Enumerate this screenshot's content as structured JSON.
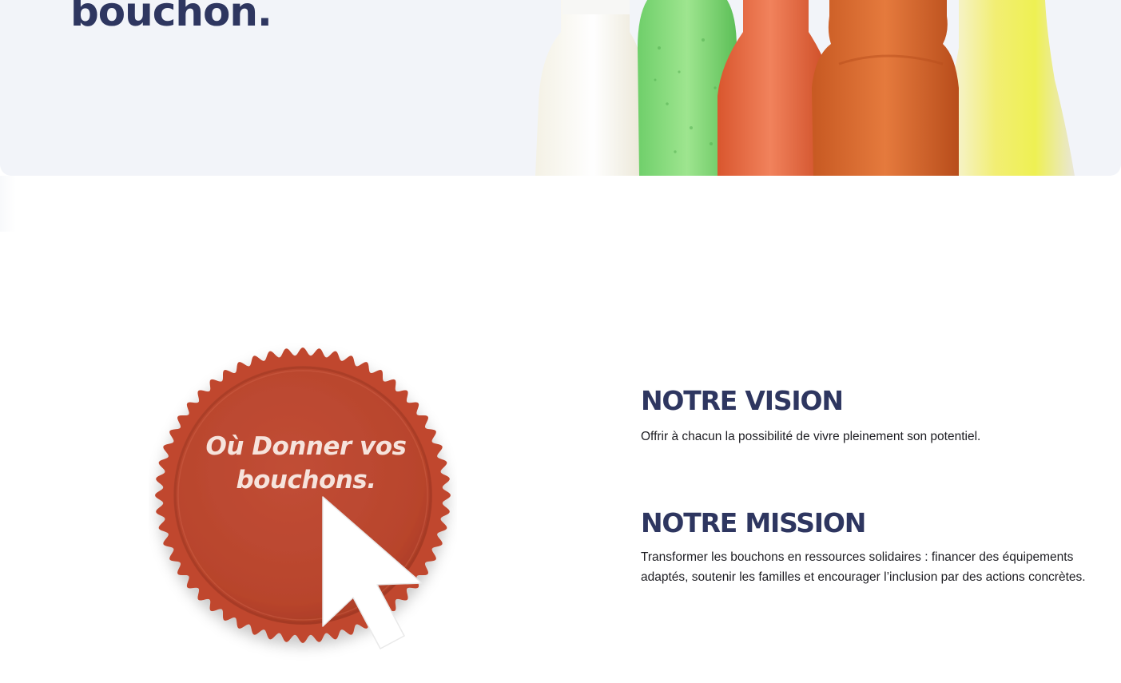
{
  "hero": {
    "title": "bouchon.",
    "image": "colorful-bottles-illustration"
  },
  "cap_link": {
    "label": "Où Donner vos bouchons.",
    "icon": "cursor-arrow-icon",
    "cap_color": "#c0472f"
  },
  "vision": {
    "heading": "NOTRE VISION",
    "text": "Offrir à chacun la possibilité de vivre pleinement son potentiel."
  },
  "mission": {
    "heading": "NOTRE MISSION",
    "text": "Transformer les bouchons en ressources solidaires : financer des équipements adaptés, soutenir les familles et encourager l’inclusion par des actions concrètes."
  },
  "colors": {
    "navy": "#2e3660",
    "hero_bg": "#f2f4f9",
    "cap_red": "#c0472f"
  }
}
